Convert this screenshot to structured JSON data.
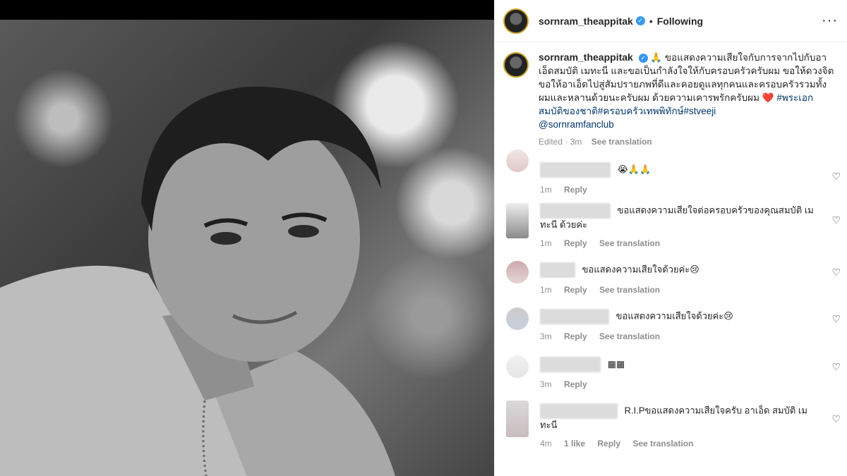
{
  "post": {
    "username": "sornram_theappitak",
    "following_label": "Following",
    "more_label": "···"
  },
  "caption": {
    "username": "sornram_theappitak",
    "text": "🙏 ขอแสดงความเสียใจกับการจากไปกับอาเอ็ดสมบัติ เมทะนี และขอเป็นกำลังใจให้กับครอบครัวครับผม ขอให้ดวงจิตขอให้อาเอ็ดไปสู่สัมปรายภพที่ดีและคอยดูแลทุกคนและครอบครัวรวมทั้งผมและหลานด้วยนะครับผม ด้วยความเคารพรักครับผม",
    "heart": "❤️",
    "hashtags": " #พระเอกสมบัติของชาติ#ครอบครัวเทพพิทักษ์#stveeji",
    "mention": "@sornramfanclub",
    "edited": "Edited",
    "time": "3m",
    "see_translation": "See translation"
  },
  "comments": [
    {
      "text": "😭🙏🙏",
      "time": "1m",
      "likes": "",
      "reply": "Reply",
      "see_translation": ""
    },
    {
      "text": "ขอแสดงความเสียใจต่อครอบครัวของคุณสมบัติ เมทะนี ด้วยค่ะ",
      "time": "1m",
      "likes": "",
      "reply": "Reply",
      "see_translation": "See translation"
    },
    {
      "text": "ขอแสดงความเสียใจด้วยค่ะ😢",
      "time": "1m",
      "likes": "",
      "reply": "Reply",
      "see_translation": "See translation"
    },
    {
      "text": "ขอแสดงความเสียใจด้วยค่ะ😢",
      "time": "3m",
      "likes": "",
      "reply": "Reply",
      "see_translation": "See translation"
    },
    {
      "text": "▦▦",
      "time": "3m",
      "likes": "",
      "reply": "Reply",
      "see_translation": ""
    },
    {
      "text": "R.I.Pขอแสดงความเสียใจครับ อาเอ็ด สมบัติ เมทะนี",
      "time": "4m",
      "likes": "1 like",
      "reply": "Reply",
      "see_translation": "See translation"
    }
  ],
  "colors": {
    "verified": "#3897f0",
    "link": "#00376b",
    "meta": "#8e8e8e",
    "avatar_ring": "#c9a227"
  },
  "icons": {
    "verified": "verified-badge-icon",
    "like": "heart-outline-icon",
    "more": "more-options-icon"
  }
}
